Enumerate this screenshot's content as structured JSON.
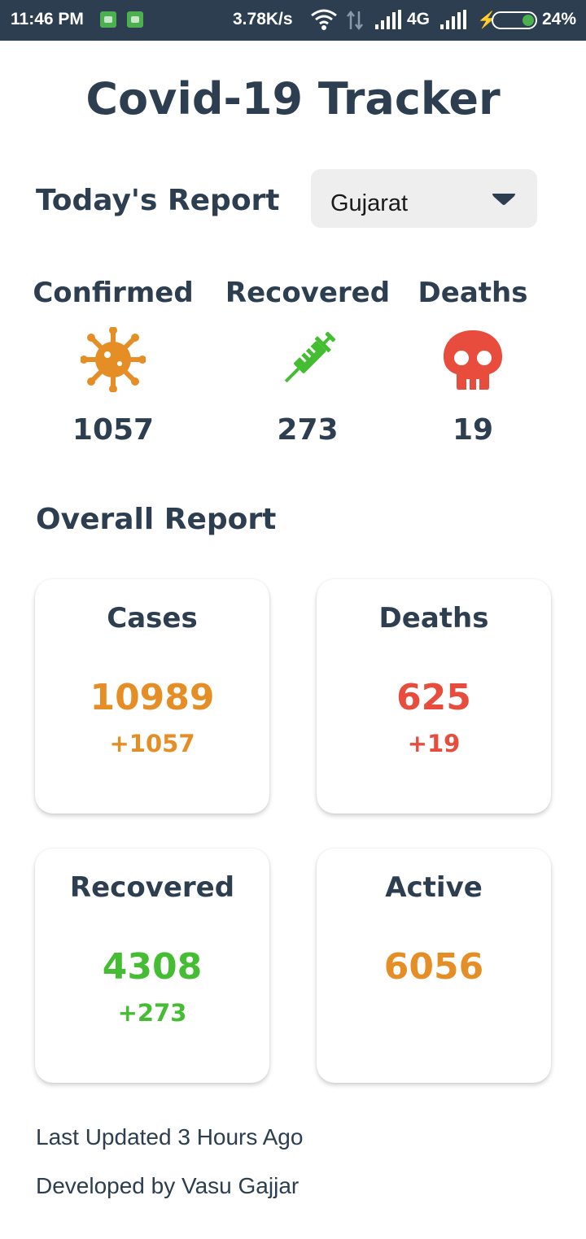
{
  "status_bar": {
    "time": "11:46 PM",
    "speed": "3.78K/s",
    "network": "4G",
    "battery": "24%",
    "battery_level": 0.24
  },
  "title": "Covid-19 Tracker",
  "today": {
    "heading": "Today's Report",
    "state_select": {
      "selected": "Gujarat"
    },
    "stats": [
      {
        "label": "Confirmed",
        "value": "1057",
        "icon": "virus-icon",
        "color": "#e58e26"
      },
      {
        "label": "Recovered",
        "value": "273",
        "icon": "syringe-icon",
        "color": "#44bd32"
      },
      {
        "label": "Deaths",
        "value": "19",
        "icon": "skull-icon",
        "color": "#e84c3d"
      }
    ]
  },
  "overall": {
    "heading": "Overall Report",
    "cards": [
      {
        "title": "Cases",
        "value": "10989",
        "delta": "+1057",
        "color": "#e58e26"
      },
      {
        "title": "Deaths",
        "value": "625",
        "delta": "+19",
        "color": "#e84c3d"
      },
      {
        "title": "Recovered",
        "value": "4308",
        "delta": "+273",
        "color": "#44bd32"
      },
      {
        "title": "Active",
        "value": "6056",
        "delta": "",
        "color": "#e58e26"
      }
    ]
  },
  "footer": {
    "last_updated": "Last Updated 3 Hours Ago",
    "developer": "Developed by Vasu Gajjar"
  },
  "colors": {
    "primary": "#2c3e50",
    "orange": "#e58e26",
    "green": "#44bd32",
    "red": "#e84c3d"
  }
}
